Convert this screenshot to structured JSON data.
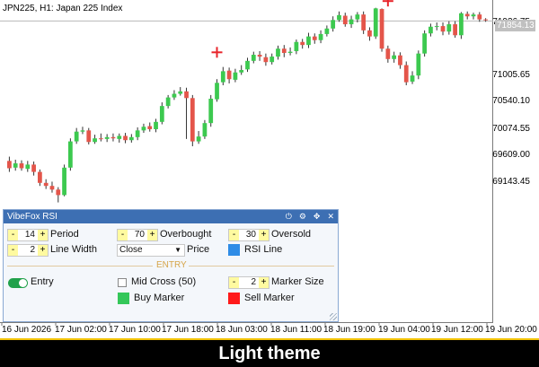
{
  "chart": {
    "title": "JPN225, H1:  Japan 225 Index",
    "current_price": "71854.13",
    "price_labels": [
      "71936.75",
      "71005.65",
      "70540.10",
      "70074.55",
      "69609.00",
      "69143.45"
    ],
    "time_labels": [
      "16 Jun 2026",
      "17 Jun 02:00",
      "17 Jun 10:00",
      "17 Jun 18:00",
      "18 Jun 03:00",
      "18 Jun 11:00",
      "18 Jun 19:00",
      "19 Jun 04:00",
      "19 Jun 12:00",
      "19 Jun 20:00"
    ]
  },
  "chart_data": {
    "type": "candlestick",
    "y_range": [
      68800,
      72080
    ],
    "up_color": "#3cc94f",
    "down_color": "#e4554a",
    "candles": [
      [
        69560,
        69440,
        69630,
        69380
      ],
      [
        69450,
        69520,
        69580,
        69400
      ],
      [
        69520,
        69440,
        69570,
        69400
      ],
      [
        69430,
        69500,
        69560,
        69380
      ],
      [
        69500,
        69380,
        69550,
        69320
      ],
      [
        69380,
        69200,
        69420,
        69150
      ],
      [
        69200,
        69150,
        69260,
        69100
      ],
      [
        69150,
        69090,
        69220,
        69040
      ],
      [
        69090,
        69000,
        69130,
        68880
      ],
      [
        69000,
        69450,
        69500,
        68980
      ],
      [
        69450,
        69880,
        69930,
        69400
      ],
      [
        69880,
        70040,
        70100,
        69840
      ],
      [
        70040,
        70060,
        70120,
        70000
      ],
      [
        70060,
        69870,
        70100,
        69830
      ],
      [
        69870,
        69930,
        69990,
        69840
      ],
      [
        69930,
        69920,
        70010,
        69880
      ],
      [
        69920,
        69950,
        70000,
        69870
      ],
      [
        69950,
        69930,
        70010,
        69880
      ],
      [
        69920,
        69970,
        70010,
        69860
      ],
      [
        69970,
        69900,
        70020,
        69850
      ],
      [
        69900,
        69950,
        70000,
        69860
      ],
      [
        69950,
        70060,
        70110,
        69900
      ],
      [
        70060,
        70120,
        70170,
        70020
      ],
      [
        70130,
        70080,
        70190,
        70040
      ],
      [
        70080,
        70200,
        70250,
        70030
      ],
      [
        70200,
        70460,
        70520,
        70160
      ],
      [
        70460,
        70600,
        70640,
        70420
      ],
      [
        70600,
        70660,
        70720,
        70560
      ],
      [
        70660,
        70700,
        70770,
        70630
      ],
      [
        70700,
        70590,
        70760,
        69920
      ],
      [
        70590,
        69880,
        70640,
        69800
      ],
      [
        69880,
        69960,
        70050,
        69840
      ],
      [
        69960,
        70180,
        70230,
        69920
      ],
      [
        70180,
        70580,
        70640,
        70120
      ],
      [
        70570,
        70840,
        70900,
        70530
      ],
      [
        70850,
        71030,
        71100,
        70800
      ],
      [
        71040,
        70900,
        71090,
        70830
      ],
      [
        70890,
        71010,
        71070,
        70850
      ],
      [
        71010,
        71050,
        71130,
        70970
      ],
      [
        71060,
        71200,
        71250,
        71020
      ],
      [
        71200,
        71300,
        71350,
        71160
      ],
      [
        71300,
        71270,
        71360,
        71200
      ],
      [
        71260,
        71180,
        71320,
        71120
      ],
      [
        71180,
        71270,
        71320,
        71140
      ],
      [
        71270,
        71400,
        71450,
        71220
      ],
      [
        71400,
        71330,
        71460,
        71260
      ],
      [
        71330,
        71350,
        71420,
        71290
      ],
      [
        71360,
        71510,
        71550,
        71310
      ],
      [
        71510,
        71460,
        71560,
        71400
      ],
      [
        71460,
        71600,
        71660,
        71410
      ],
      [
        71600,
        71540,
        71650,
        71480
      ],
      [
        71540,
        71640,
        71700,
        71490
      ],
      [
        71640,
        71730,
        71780,
        71600
      ],
      [
        71730,
        71870,
        71930,
        71680
      ],
      [
        71870,
        71950,
        72010,
        71840
      ],
      [
        71940,
        71800,
        71990,
        71760
      ],
      [
        71800,
        71880,
        71940,
        71740
      ],
      [
        71880,
        71960,
        72000,
        71830
      ],
      [
        71960,
        71700,
        72010,
        71640
      ],
      [
        71700,
        71600,
        71750,
        71530
      ],
      [
        71600,
        72060,
        72070,
        71560
      ],
      [
        72050,
        71400,
        72060,
        71350
      ],
      [
        71400,
        71230,
        71450,
        71170
      ],
      [
        71230,
        71290,
        71350,
        71170
      ],
      [
        71290,
        71130,
        71340,
        71070
      ],
      [
        71130,
        70850,
        71190,
        70800
      ],
      [
        70860,
        70960,
        71030,
        70820
      ],
      [
        70960,
        71320,
        71370,
        70900
      ],
      [
        71320,
        71650,
        71700,
        71270
      ],
      [
        71650,
        71760,
        71810,
        71600
      ],
      [
        71760,
        71770,
        71830,
        71700
      ],
      [
        71770,
        71680,
        71830,
        71620
      ],
      [
        71680,
        71800,
        71850,
        71630
      ],
      [
        71800,
        71620,
        71850,
        71580
      ],
      [
        71620,
        71980,
        72000,
        71560
      ],
      [
        71970,
        71930,
        72010,
        71880
      ],
      [
        71930,
        71960,
        71990,
        71880
      ],
      [
        71960,
        71880,
        72000,
        71840
      ],
      [
        71880,
        71870,
        71900,
        71840
      ]
    ],
    "markers": [
      {
        "candle": 34,
        "price": 71340,
        "color": "#e8252b"
      },
      {
        "candle": 62,
        "price": 72180,
        "color": "#e8252b"
      }
    ]
  },
  "panel": {
    "title": "VibeFox RSI",
    "header_icons": [
      "power-icon",
      "settings-icon",
      "move-icon",
      "close-icon"
    ],
    "period": {
      "value": "14",
      "label": "Period"
    },
    "overbought": {
      "value": "70",
      "label": "Overbought"
    },
    "oversold": {
      "value": "30",
      "label": "Oversold"
    },
    "line_width": {
      "value": "2",
      "label": "Line Width"
    },
    "price": {
      "selected": "Close",
      "label": "Price"
    },
    "rsi_line": {
      "label": "RSI Line",
      "color": "#2f8ce6"
    },
    "section_entry": "ENTRY",
    "entry": {
      "label": "Entry",
      "on": true
    },
    "mid_cross": {
      "label": "Mid Cross (50)",
      "checked": false
    },
    "marker_size": {
      "value": "2",
      "label": "Marker Size"
    },
    "buy_marker": {
      "label": "Buy Marker",
      "color": "#34c759"
    },
    "sell_marker": {
      "label": "Sell Marker",
      "color": "#ff1a1a"
    },
    "btn_minus": "-",
    "btn_plus": "+"
  },
  "footer": {
    "text": "Light theme"
  }
}
